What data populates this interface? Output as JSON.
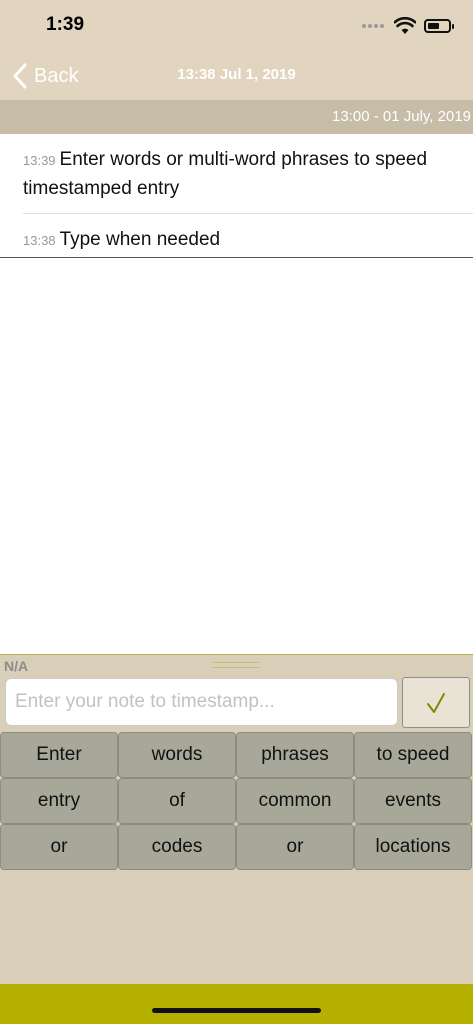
{
  "status_bar": {
    "time": "1:39"
  },
  "nav": {
    "back_label": "Back",
    "title": "13:38 Jul 1, 2019"
  },
  "section": {
    "header": "13:00 - 01 July, 2019"
  },
  "entries": [
    {
      "time": "13:39",
      "text": "Enter words or multi-word phrases to speed timestamped entry"
    },
    {
      "time": "13:38",
      "text": "Type when needed"
    }
  ],
  "compose": {
    "na_label": "N/A",
    "placeholder": "Enter your note to timestamp...",
    "value": ""
  },
  "phrase_keys": [
    "Enter",
    "words",
    "phrases",
    "to speed",
    "entry",
    "of",
    "common",
    "events",
    "or",
    "codes",
    "or",
    "locations"
  ],
  "colors": {
    "header_bg": "#e1d5c0",
    "section_bg": "#c7bca7",
    "key_bg": "#a7a899",
    "accent": "#b6b100",
    "checkmark": "#8a8500"
  }
}
